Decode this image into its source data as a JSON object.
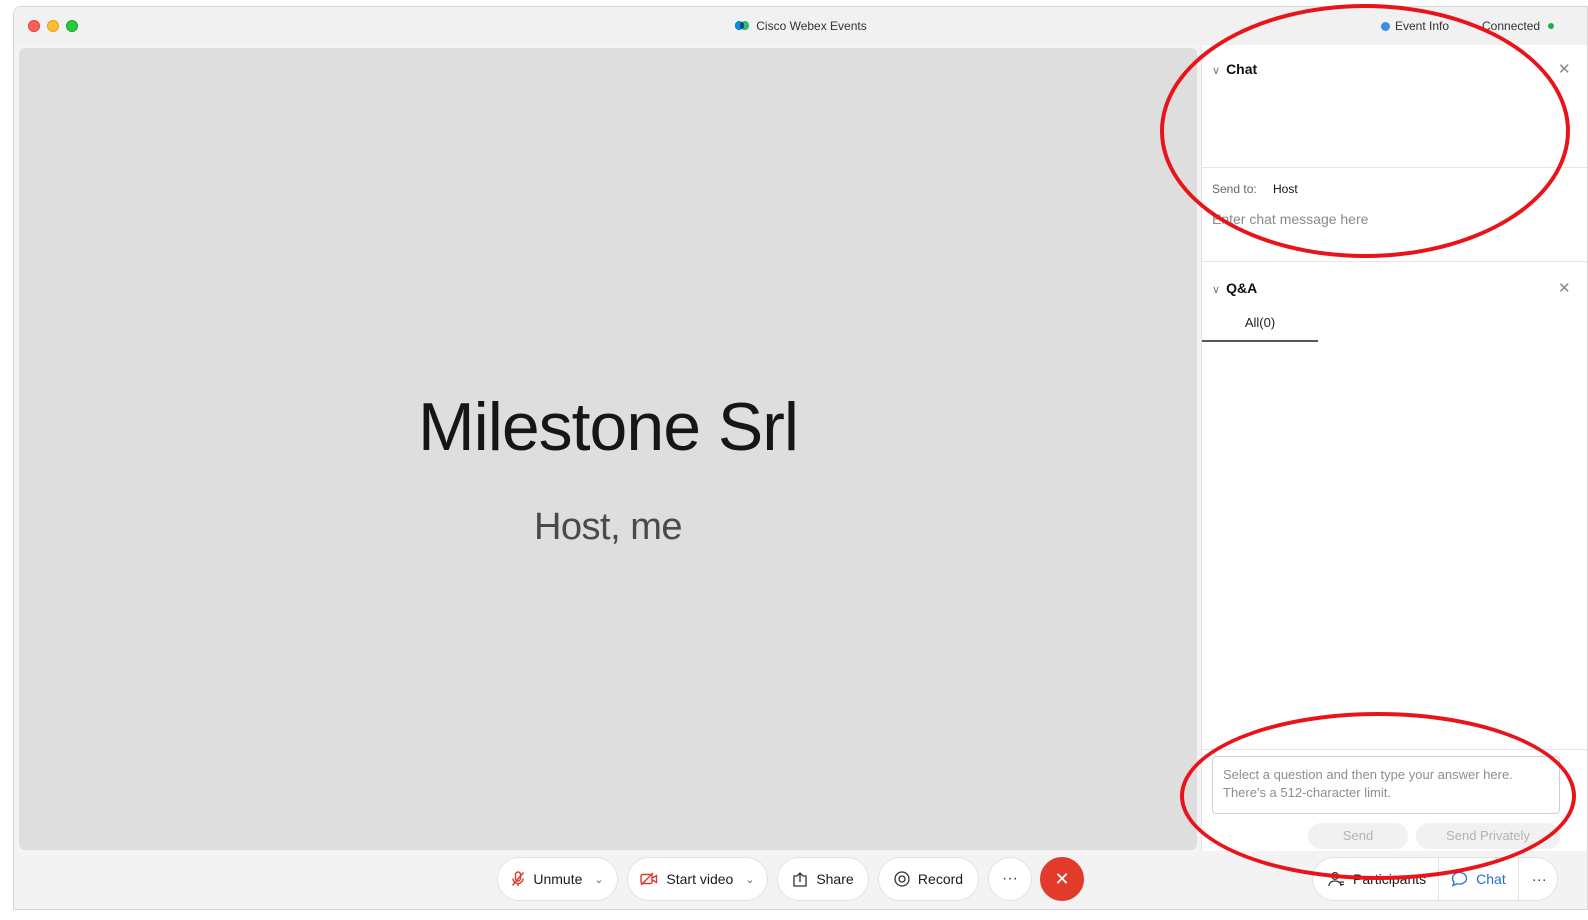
{
  "window": {
    "app_title": "Cisco Webex Events",
    "event_info_label": "Event Info",
    "connection_status": "Connected"
  },
  "stage": {
    "presenter_name": "Milestone Srl",
    "presenter_role": "Host, me"
  },
  "chat": {
    "title": "Chat",
    "send_to_label": "Send to:",
    "send_to_value": "Host",
    "input_placeholder": "Enter chat message here"
  },
  "qa": {
    "title": "Q&A",
    "tabs": [
      {
        "label": "All(0)",
        "selected": true
      }
    ],
    "answer_placeholder": "Select a question and then type your answer here. There's a 512-character limit.",
    "send_label": "Send",
    "send_privately_label": "Send Privately"
  },
  "controls": {
    "unmute_label": "Unmute",
    "start_video_label": "Start video",
    "share_label": "Share",
    "record_label": "Record",
    "more_label": "···",
    "leave_label": "✕",
    "participants_label": "Participants",
    "chat_label": "Chat",
    "panel_more_label": "···"
  },
  "colors": {
    "leave_red": "#e23b2a",
    "chat_active_blue": "#1f6fd6",
    "connected_green": "#1bb04b",
    "annotation_red": "#e8141a",
    "stage_gray": "#dedede"
  },
  "icons": {
    "title_logo": "webex-logo-icon",
    "unmute": "mic-muted-icon",
    "start_video": "video-off-icon",
    "share": "share-icon",
    "record": "record-icon",
    "participants": "participants-icon",
    "chat": "chat-bubble-icon"
  }
}
